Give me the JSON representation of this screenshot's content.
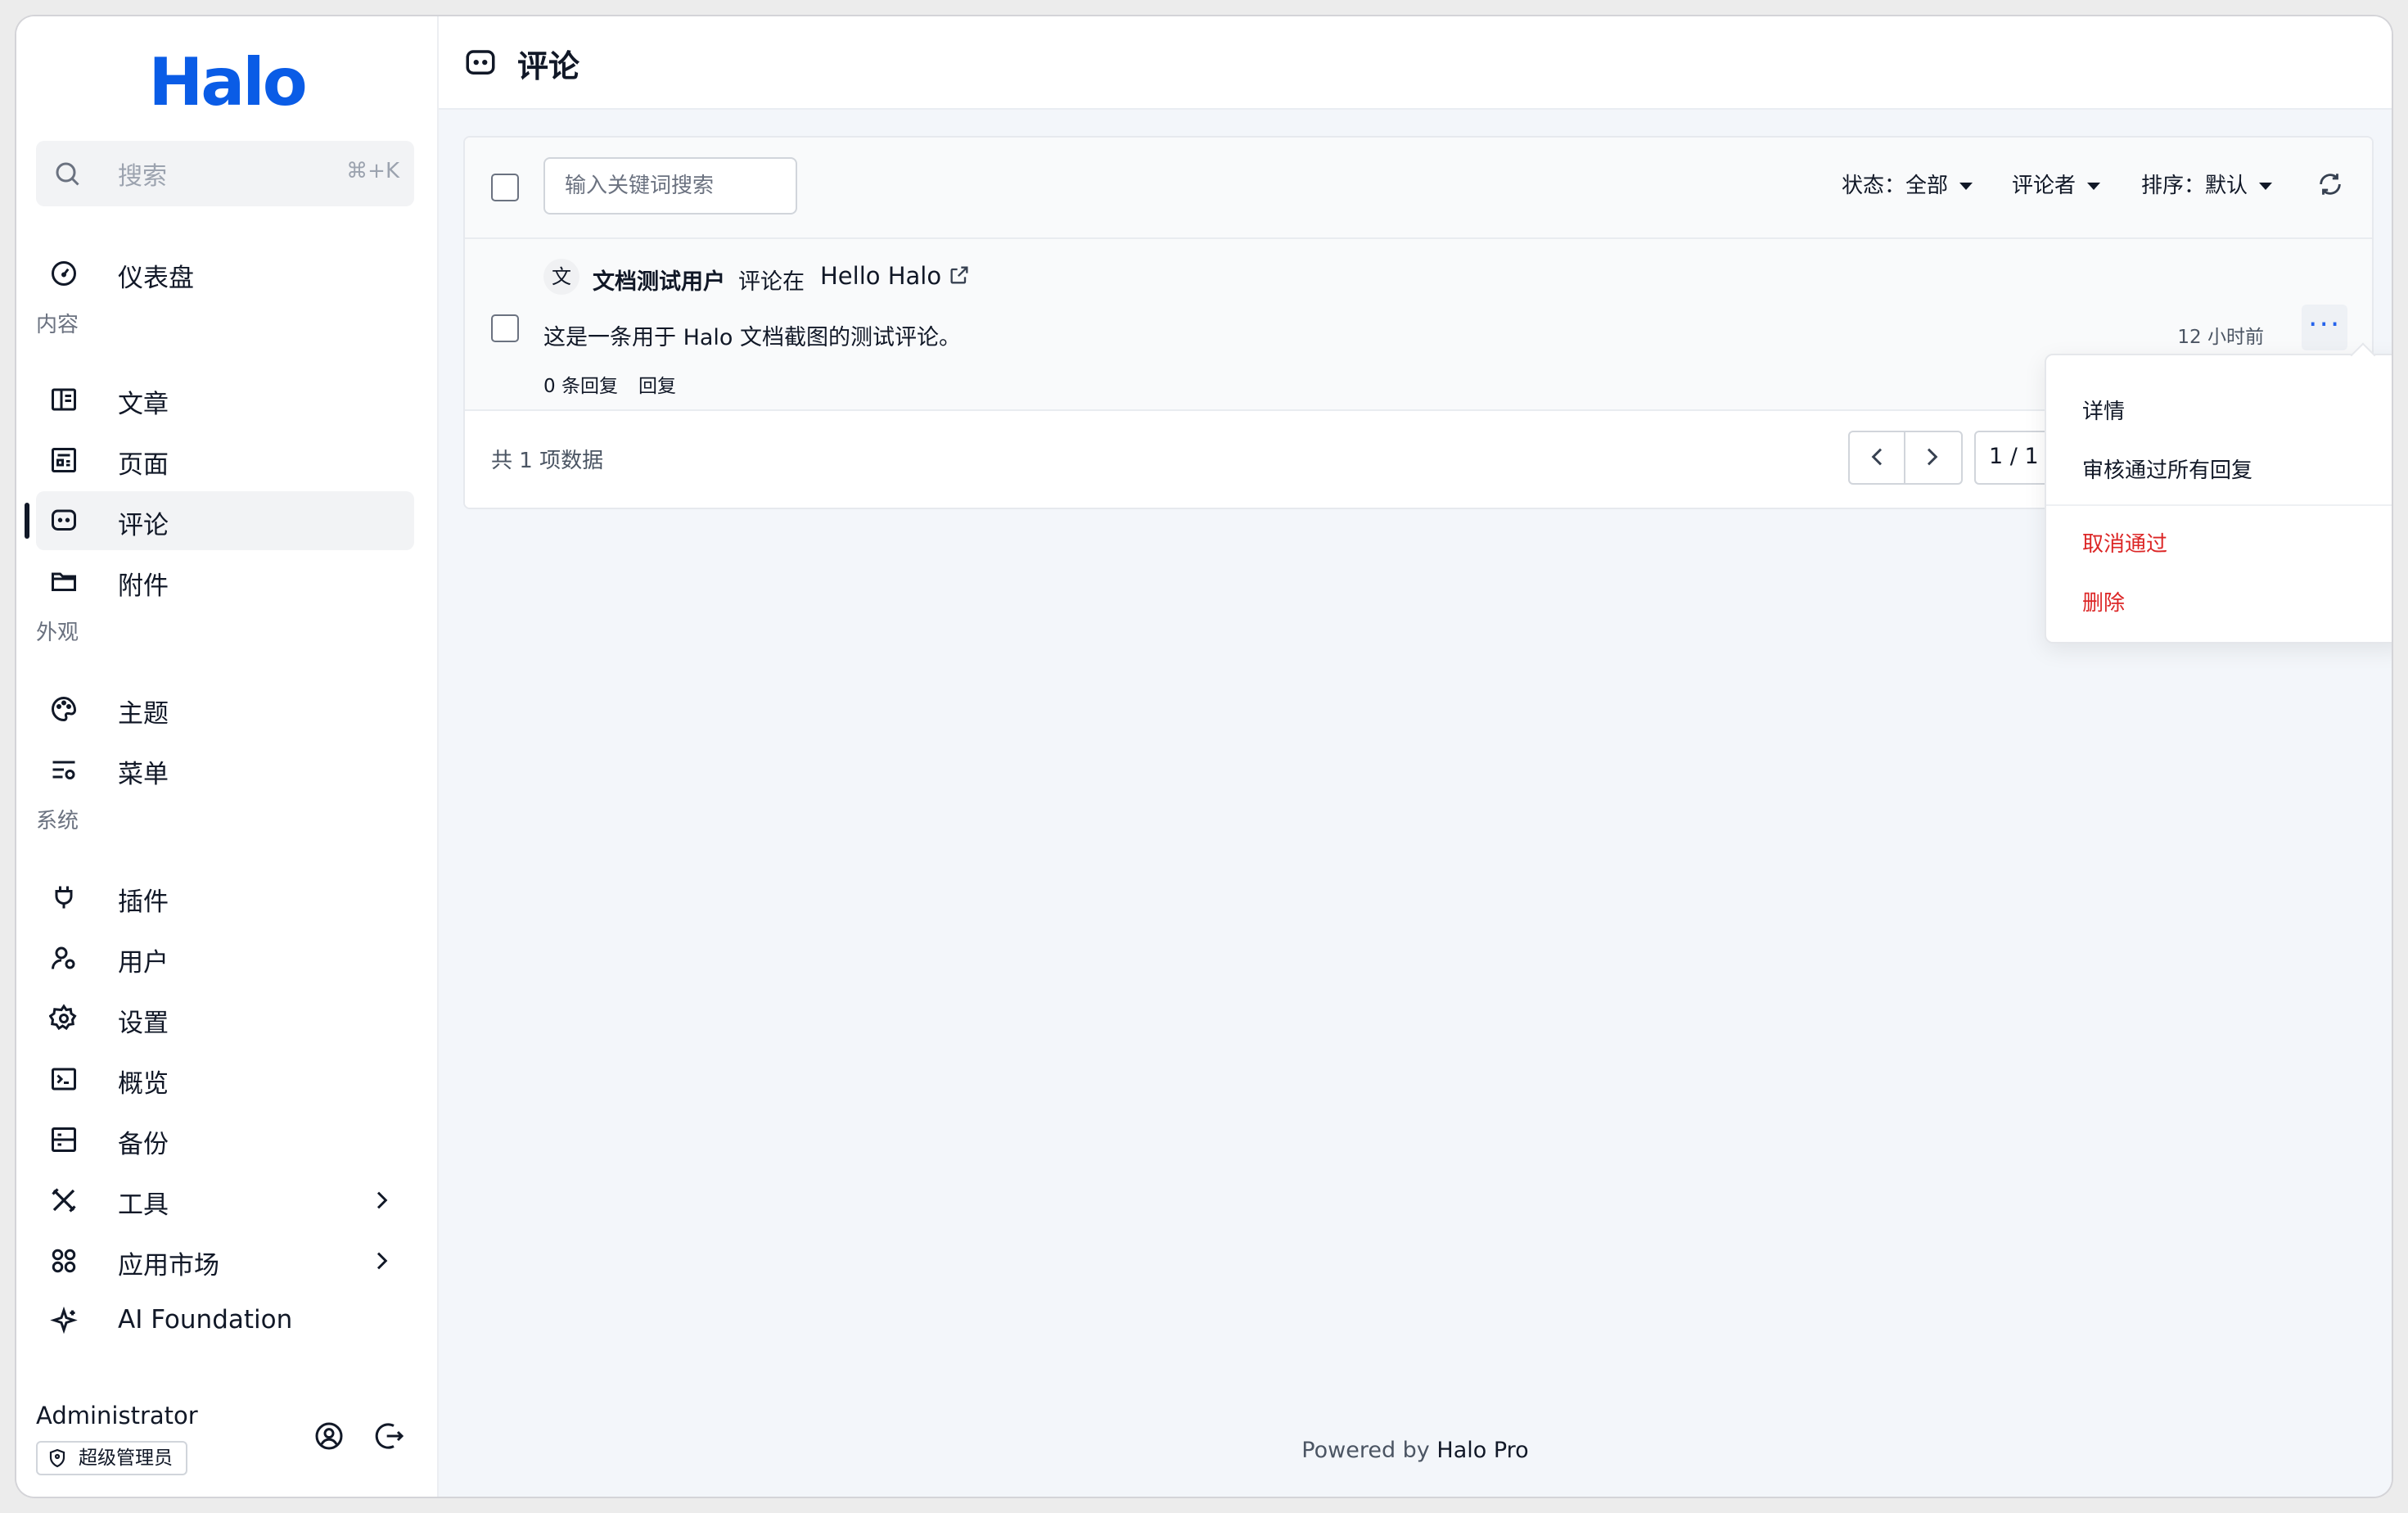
{
  "app": {
    "logo": "Halo"
  },
  "search": {
    "placeholder": "搜索",
    "shortcut": "⌘+K"
  },
  "sidebar": {
    "dashboard": "仪表盘",
    "groups": {
      "content": "内容",
      "appearance": "外观",
      "system": "系统"
    },
    "content_items": [
      "文章",
      "页面",
      "评论",
      "附件"
    ],
    "appearance_items": [
      "主题",
      "菜单"
    ],
    "system_items": [
      "插件",
      "用户",
      "设置",
      "概览",
      "备份",
      "工具",
      "应用市场",
      "AI Foundation"
    ],
    "active": "评论"
  },
  "user": {
    "name": "Administrator",
    "role": "超级管理员"
  },
  "page": {
    "title": "评论"
  },
  "filters": {
    "keyword_placeholder": "输入关键词搜索",
    "status": "状态：全部",
    "commenter": "评论者",
    "sort": "排序：默认"
  },
  "comment": {
    "avatar_text": "文",
    "author": "文档测试用户",
    "action": "评论在",
    "target": "Hello Halo",
    "content": "这是一条用于 Halo 文档截图的测试评论。",
    "reply_count": "0 条回复",
    "reply_label": "回复",
    "time": "12 小时前"
  },
  "pagination": {
    "total": "共 1 项数据",
    "page": "1 / 1"
  },
  "dropdown": {
    "detail": "详情",
    "approve_all_replies": "审核通过所有回复",
    "cancel_approval": "取消通过",
    "delete": "删除"
  },
  "footer": {
    "prefix": "Powered by",
    "brand": "Halo Pro"
  },
  "colors": {
    "brand": "#0a5ce6",
    "danger": "#dc2626",
    "accent": "#2563eb"
  }
}
